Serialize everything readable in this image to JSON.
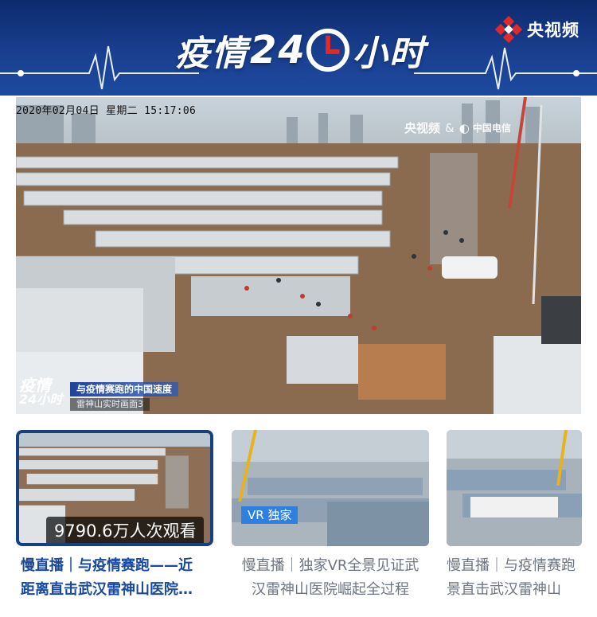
{
  "header": {
    "brand": "央视频",
    "show_title_pre": "疫情",
    "show_title_num": "24",
    "show_title_post": "小时"
  },
  "live": {
    "timestamp": "2020年02月04日  星期二  15:17:06",
    "watermark_brand": "央视频",
    "watermark_amp": "&",
    "watermark_partner": "中国电信",
    "overlay_logo_top": "疫情",
    "overlay_logo_bottom": "24小时",
    "caption": "与疫情赛跑的中国速度",
    "subcaption": "雷神山实时画面3"
  },
  "streams": [
    {
      "title_line1": "慢直播｜与疫情赛跑——近",
      "title_line2": "距离直击武汉雷神山医院…",
      "views": "9790.6万人次观看",
      "active": true
    },
    {
      "title_line1": "慢直播｜独家VR全景见证武",
      "title_line2": "汉雷神山医院崛起全过程",
      "badge": "VR 独家",
      "active": false
    },
    {
      "title_line1": "慢直播｜与疫情赛跑",
      "title_line2": "景直击武汉雷神山",
      "active": false
    }
  ],
  "colors": {
    "header_bg": "#1a3f8f",
    "accent_red": "#e02a2a",
    "active_border": "#17407e",
    "active_title": "#1a49a0",
    "inactive_title": "#6d7582",
    "vr_badge": "#2f7fe0"
  },
  "icons": [
    "cctv-logo-icon",
    "clock-icon",
    "heartbeat-line-icon",
    "telecom-icon"
  ]
}
